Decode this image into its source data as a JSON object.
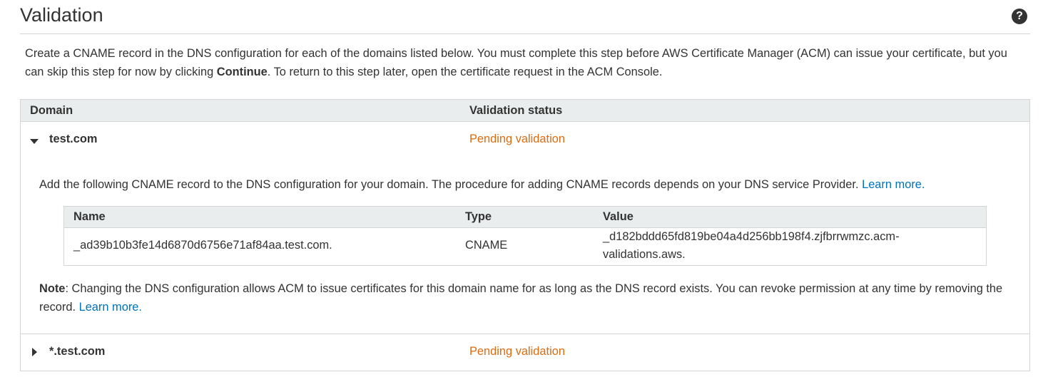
{
  "header": {
    "title": "Validation",
    "help_icon": "help-icon"
  },
  "intro": {
    "text_before": "Create a CNAME record in the DNS configuration for each of the domains listed below. You must complete this step before AWS Certificate Manager (ACM) can issue your certificate, but you can skip this step for now by clicking ",
    "bold": "Continue",
    "text_after": ". To return to this step later, open the certificate request in the ACM Console."
  },
  "table": {
    "columns": [
      "Domain",
      "Validation status"
    ],
    "rows": [
      {
        "domain": "test.com",
        "status": "Pending validation",
        "expanded": true,
        "detail": {
          "text": "Add the following CNAME record to the DNS configuration for your domain. The procedure for adding CNAME records depends on your DNS service Provider.",
          "link": "Learn more.",
          "record_columns": [
            "Name",
            "Type",
            "Value"
          ],
          "record": {
            "name": "_ad39b10b3fe14d6870d6756e71af84aa.test.com.",
            "type": "CNAME",
            "value_line1": "_d182bddd65fd819be04a4d256bb198f4.zjfbrrwmzc.acm-",
            "value_line2": "validations.aws."
          },
          "note_label": "Note",
          "note_text": ": Changing the DNS configuration allows ACM to issue certificates for this domain name for as long as the DNS record exists. You can revoke permission at any time by removing the record.",
          "note_link": "Learn more."
        }
      },
      {
        "domain": "*.test.com",
        "status": "Pending validation",
        "expanded": false
      }
    ]
  },
  "colors": {
    "pending": "#dd6b10",
    "link": "#0073bb",
    "header_bg": "#eaeded",
    "border": "#d5d5d5"
  }
}
